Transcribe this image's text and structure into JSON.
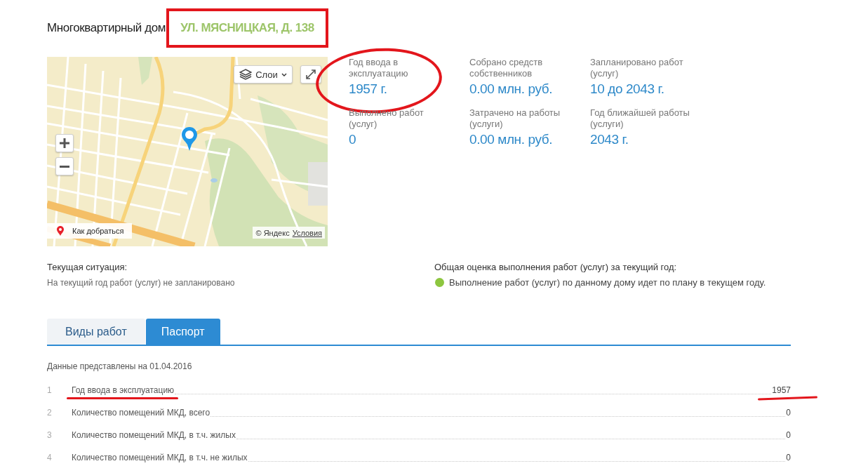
{
  "header": {
    "prefix": "Многоквартирный дом",
    "address": "УЛ. МЯСНИЦКАЯ, Д. 138",
    "address_boxed": true
  },
  "map": {
    "layers_button": "Слои",
    "route_button": "Как добраться",
    "attribution": "© Яндекс",
    "terms_link": "Условия"
  },
  "stats": [
    {
      "label": "Год ввода в эксплуатацию",
      "value": "1957 г.",
      "circled": true
    },
    {
      "label": "Собрано средств собственников",
      "value": "0.00 млн. руб.",
      "circled": false
    },
    {
      "label": "Запланировано работ (услуг)",
      "value": "10 до 2043 г.",
      "circled": false
    },
    {
      "label": "Выполнено работ (услуг)",
      "value": "0",
      "circled": false
    },
    {
      "label": "Затрачено на работы (услуги)",
      "value": "0.00 млн. руб.",
      "circled": false
    },
    {
      "label": "Год ближайшей работы (услуги)",
      "value": "2043 г.",
      "circled": false
    }
  ],
  "current_situation": {
    "title": "Текущая ситуация:",
    "text": "На текущий год работ (услуг) не запланировано"
  },
  "assessment": {
    "title": "Общая оценка выполнения работ (услуг) за текущий год:",
    "color": "#8dc63f",
    "text": "Выполнение работ (услуг) по данному дому идет по плану в текущем году."
  },
  "tabs": [
    {
      "label": "Виды работ",
      "selected": false
    },
    {
      "label": "Паспорт",
      "selected": true
    }
  ],
  "passport": {
    "date_note": "Данные представлены на 01.04.2016",
    "rows": [
      {
        "number": "1",
        "label": "Год ввода в эксплуатацию",
        "value": "1957",
        "underlined": true
      },
      {
        "number": "2",
        "label": "Количество помещений МКД, всего",
        "value": "0",
        "underlined": false
      },
      {
        "number": "3",
        "label": "Количество помещений МКД, в т.ч. жилых",
        "value": "0",
        "underlined": false
      },
      {
        "number": "4",
        "label": "Количество помещений МКД, в т.ч. не жилых",
        "value": "0",
        "underlined": false
      }
    ]
  }
}
